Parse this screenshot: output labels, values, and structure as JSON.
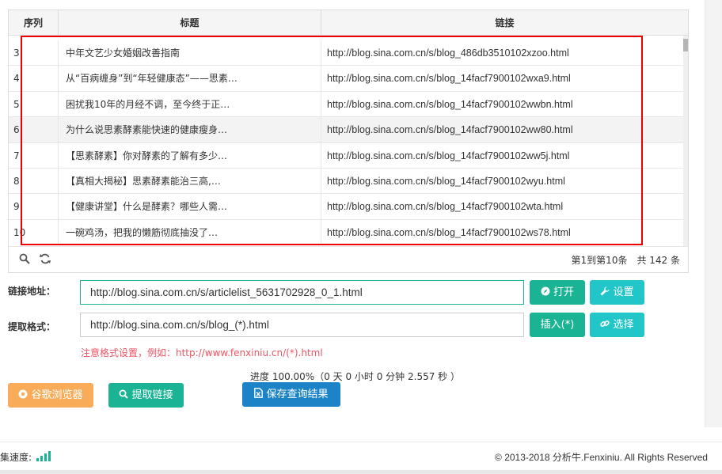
{
  "table": {
    "headers": [
      "序列",
      "标题",
      "链接"
    ],
    "rows": [
      {
        "index": "3",
        "title": "中年文艺少女婚姻改善指南",
        "link": "http://blog.sina.com.cn/s/blog_486db3510102xzoo.html"
      },
      {
        "index": "4",
        "title": "从“百病缠身”到“年轻健康态”——思素…",
        "link": "http://blog.sina.com.cn/s/blog_14facf7900102wxa9.html"
      },
      {
        "index": "5",
        "title": "困扰我10年的月经不调，至今终于正…",
        "link": "http://blog.sina.com.cn/s/blog_14facf7900102wwbn.html"
      },
      {
        "index": "6",
        "title": "为什么说思素酵素能快速的健康瘦身…",
        "link": "http://blog.sina.com.cn/s/blog_14facf7900102ww80.html"
      },
      {
        "index": "7",
        "title": "【思素酵素】你对酵素的了解有多少…",
        "link": "http://blog.sina.com.cn/s/blog_14facf7900102ww5j.html"
      },
      {
        "index": "8",
        "title": "【真相大揭秘】思素酵素能治三高,…",
        "link": "http://blog.sina.com.cn/s/blog_14facf7900102wyu.html"
      },
      {
        "index": "9",
        "title": "【健康讲堂】什么是酵素？哪些人需…",
        "link": "http://blog.sina.com.cn/s/blog_14facf7900102wta.html"
      },
      {
        "index": "10",
        "title": "一碗鸡汤，把我的懒筋彻底抽没了…",
        "link": "http://blog.sina.com.cn/s/blog_14facf7900102ws78.html"
      }
    ],
    "pagination": "第1到第10条　共 142 条"
  },
  "form": {
    "url_label": "链接地址：",
    "url_value": "http://blog.sina.com.cn/s/articlelist_5631702928_0_1.html",
    "open_label": "打开",
    "settings_label": "设置",
    "format_label": "提取格式：",
    "format_value": "http://blog.sina.com.cn/s/blog_(*).html",
    "insert_label": "插入(*)",
    "select_label": "选择",
    "hint": "注意格式设置，例如：http://www.fenxiniu.cn/(*).html"
  },
  "progress_text": "进度 100.00%（0 天 0 小时 0 分钟 2.557 秒 ）",
  "actions": {
    "browser_label": "谷歌浏览器",
    "extract_label": "提取链接",
    "save_label": "保存查询结果"
  },
  "footer": {
    "speed_label": "集速度:",
    "copyright": "© 2013-2018 分析牛.Fenxiniu. All Rights Reserved"
  },
  "colors": {
    "green": "#1ab394",
    "cyan": "#23c6c8",
    "orange": "#f8ac59",
    "blue": "#1c84c6",
    "highlight_border": "#e00000",
    "hint_red": "#ed5565"
  }
}
